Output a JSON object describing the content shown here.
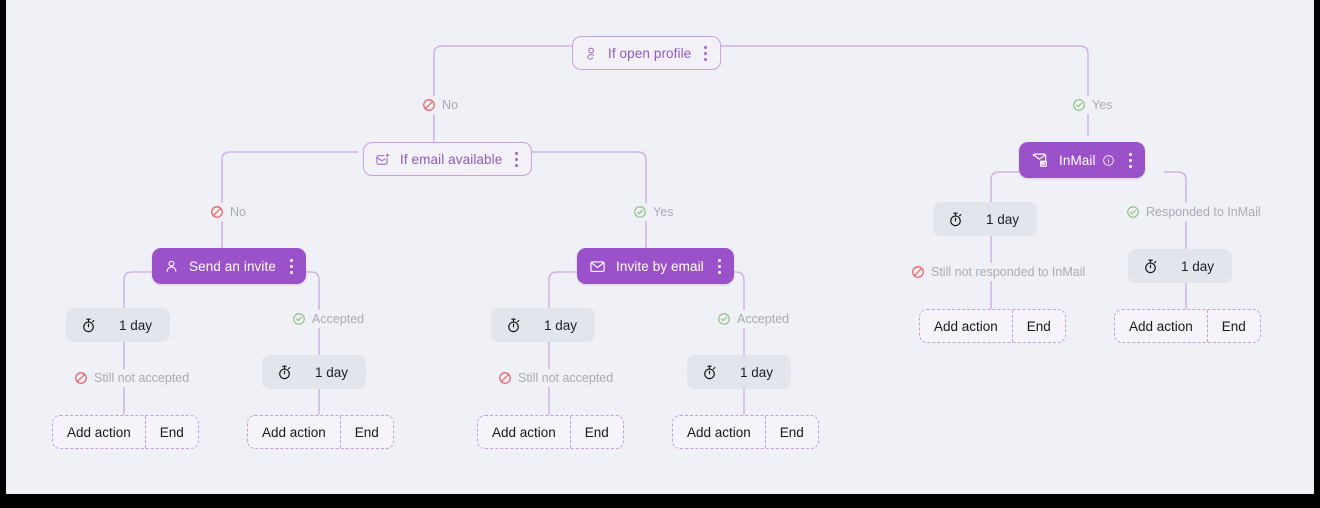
{
  "theme": {
    "background": "#f0f1f6",
    "accent_purple": "#9b51c9",
    "condition_border": "#c3a3de",
    "condition_text": "#8f5cc0",
    "delay_bg": "#e2e5ec",
    "edge_line": "#c9a9e3",
    "label_text": "#a9abb4",
    "negative_icon": "#f0565c",
    "positive_icon": "#8dc27e",
    "frame": "#000000"
  },
  "flow": {
    "nodes": {
      "if_open_profile": {
        "label": "If open profile",
        "icon": "profile-check-icon",
        "type": "condition",
        "menu": "node-menu-icon"
      },
      "if_email_available": {
        "label": "If email available",
        "icon": "email-available-icon",
        "type": "condition",
        "menu": "node-menu-icon"
      },
      "send_an_invite": {
        "label": "Send an invite",
        "icon": "person-icon",
        "type": "action",
        "menu": "node-menu-icon"
      },
      "invite_by_email": {
        "label": "Invite by email",
        "icon": "envelope-icon",
        "type": "action",
        "menu": "node-menu-icon"
      },
      "inmail": {
        "label": "InMail",
        "icon": "inmail-icon",
        "info": "info-icon",
        "type": "action",
        "menu": "node-menu-icon"
      }
    },
    "delays": {
      "d1": {
        "label": "1 day",
        "icon": "stopwatch-icon"
      },
      "d2": {
        "label": "1 day",
        "icon": "stopwatch-icon"
      },
      "d3": {
        "label": "1 day",
        "icon": "stopwatch-icon"
      },
      "d4": {
        "label": "1 day",
        "icon": "stopwatch-icon"
      },
      "d5": {
        "label": "1 day",
        "icon": "stopwatch-icon"
      },
      "d6": {
        "label": "1 day",
        "icon": "stopwatch-icon"
      }
    },
    "branch_labels": {
      "root_no": {
        "text": "No",
        "icon": "ban-icon",
        "polarity": "negative"
      },
      "root_yes": {
        "text": "Yes",
        "icon": "check-circle-icon",
        "polarity": "positive"
      },
      "email_no": {
        "text": "No",
        "icon": "ban-icon",
        "polarity": "negative"
      },
      "email_yes": {
        "text": "Yes",
        "icon": "check-circle-icon",
        "polarity": "positive"
      },
      "invite_accepted": {
        "text": "Accepted",
        "icon": "check-circle-icon",
        "polarity": "positive"
      },
      "invite_not_accepted": {
        "text": "Still not accepted",
        "icon": "ban-icon",
        "polarity": "negative"
      },
      "email_accepted": {
        "text": "Accepted",
        "icon": "check-circle-icon",
        "polarity": "positive"
      },
      "email_not_accepted": {
        "text": "Still not accepted",
        "icon": "ban-icon",
        "polarity": "negative"
      },
      "inmail_responded": {
        "text": "Responded to InMail",
        "icon": "check-circle-icon",
        "polarity": "positive"
      },
      "inmail_not_responded": {
        "text": "Still not responded to InMail",
        "icon": "ban-icon",
        "polarity": "negative"
      }
    },
    "terminals": {
      "t1": {
        "add": "Add action",
        "end": "End"
      },
      "t2": {
        "add": "Add action",
        "end": "End"
      },
      "t3": {
        "add": "Add action",
        "end": "End"
      },
      "t4": {
        "add": "Add action",
        "end": "End"
      },
      "t5": {
        "add": "Add action",
        "end": "End"
      },
      "t6": {
        "add": "Add action",
        "end": "End"
      }
    }
  }
}
